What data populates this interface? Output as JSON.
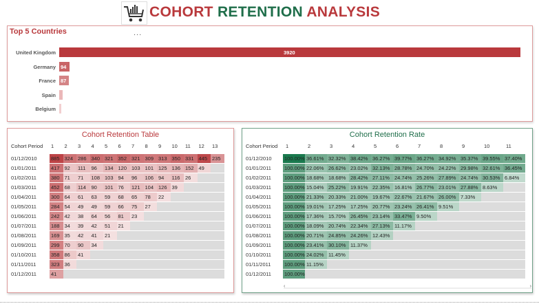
{
  "header": {
    "title_part1": "COHORT",
    "title_part2": "RETENTION",
    "title_part3": "ANALYSIS",
    "logo_icon": "shopping-cart-chart-icon"
  },
  "top_countries": {
    "title": "Top 5 Countries",
    "menu": "...",
    "bar_color": "#b9393c",
    "items": [
      {
        "country": "United Kingdom",
        "value": 3920
      },
      {
        "country": "Germany",
        "value": 94
      },
      {
        "country": "France",
        "value": 87
      },
      {
        "country": "Spain",
        "value": null
      },
      {
        "country": "Belgium",
        "value": null
      }
    ]
  },
  "retention_table": {
    "title": "Cohort Retention Table",
    "period_header": "Cohort Period",
    "columns": [
      "1",
      "2",
      "3",
      "4",
      "5",
      "6",
      "7",
      "8",
      "9",
      "10",
      "11",
      "12",
      "13"
    ],
    "rows": [
      {
        "cohort": "01/12/2010",
        "values": [
          "885",
          "324",
          "286",
          "340",
          "321",
          "352",
          "321",
          "309",
          "313",
          "350",
          "331",
          "445",
          "235"
        ]
      },
      {
        "cohort": "01/01/2011",
        "values": [
          "417",
          "92",
          "111",
          "96",
          "134",
          "120",
          "103",
          "101",
          "125",
          "136",
          "152",
          "49"
        ]
      },
      {
        "cohort": "01/02/2011",
        "values": [
          "380",
          "71",
          "71",
          "108",
          "103",
          "94",
          "96",
          "106",
          "94",
          "116",
          "26"
        ]
      },
      {
        "cohort": "01/03/2011",
        "values": [
          "452",
          "68",
          "114",
          "90",
          "101",
          "76",
          "121",
          "104",
          "126",
          "39"
        ]
      },
      {
        "cohort": "01/04/2011",
        "values": [
          "300",
          "64",
          "61",
          "63",
          "59",
          "68",
          "65",
          "78",
          "22"
        ]
      },
      {
        "cohort": "01/05/2011",
        "values": [
          "284",
          "54",
          "49",
          "49",
          "59",
          "66",
          "75",
          "27"
        ]
      },
      {
        "cohort": "01/06/2011",
        "values": [
          "242",
          "42",
          "38",
          "64",
          "56",
          "81",
          "23"
        ]
      },
      {
        "cohort": "01/07/2011",
        "values": [
          "188",
          "34",
          "39",
          "42",
          "51",
          "21"
        ]
      },
      {
        "cohort": "01/08/2011",
        "values": [
          "169",
          "35",
          "42",
          "41",
          "21"
        ]
      },
      {
        "cohort": "01/09/2011",
        "values": [
          "299",
          "70",
          "90",
          "34"
        ]
      },
      {
        "cohort": "01/10/2011",
        "values": [
          "358",
          "86",
          "41"
        ]
      },
      {
        "cohort": "01/11/2011",
        "values": [
          "323",
          "36"
        ]
      },
      {
        "cohort": "01/12/2011",
        "values": [
          "41"
        ]
      }
    ]
  },
  "retention_rate": {
    "title": "Cohort Retention Rate",
    "period_header": "Cohort Period",
    "columns": [
      "1",
      "2",
      "3",
      "4",
      "5",
      "6",
      "7",
      "8",
      "9",
      "10",
      "11"
    ],
    "rows": [
      {
        "cohort": "01/12/2010",
        "values": [
          "100.00%",
          "36.61%",
          "32.32%",
          "38.42%",
          "36.27%",
          "39.77%",
          "36.27%",
          "34.92%",
          "35.37%",
          "39.55%",
          "37.40%"
        ]
      },
      {
        "cohort": "01/01/2011",
        "values": [
          "100.00%",
          "22.06%",
          "26.62%",
          "23.02%",
          "32.13%",
          "28.78%",
          "24.70%",
          "24.22%",
          "29.98%",
          "32.61%",
          "36.45%"
        ]
      },
      {
        "cohort": "01/02/2011",
        "values": [
          "100.00%",
          "18.68%",
          "18.68%",
          "28.42%",
          "27.11%",
          "24.74%",
          "25.26%",
          "27.89%",
          "24.74%",
          "30.53%",
          "6.84%"
        ]
      },
      {
        "cohort": "01/03/2011",
        "values": [
          "100.00%",
          "15.04%",
          "25.22%",
          "19.91%",
          "22.35%",
          "16.81%",
          "26.77%",
          "23.01%",
          "27.88%",
          "8.63%"
        ]
      },
      {
        "cohort": "01/04/2011",
        "values": [
          "100.00%",
          "21.33%",
          "20.33%",
          "21.00%",
          "19.67%",
          "22.67%",
          "21.67%",
          "26.00%",
          "7.33%"
        ]
      },
      {
        "cohort": "01/05/2011",
        "values": [
          "100.00%",
          "19.01%",
          "17.25%",
          "17.25%",
          "20.77%",
          "23.24%",
          "26.41%",
          "9.51%"
        ]
      },
      {
        "cohort": "01/06/2011",
        "values": [
          "100.00%",
          "17.36%",
          "15.70%",
          "26.45%",
          "23.14%",
          "33.47%",
          "9.50%"
        ]
      },
      {
        "cohort": "01/07/2011",
        "values": [
          "100.00%",
          "18.09%",
          "20.74%",
          "22.34%",
          "27.13%",
          "11.17%"
        ]
      },
      {
        "cohort": "01/08/2011",
        "values": [
          "100.00%",
          "20.71%",
          "24.85%",
          "24.26%",
          "12.43%"
        ]
      },
      {
        "cohort": "01/09/2011",
        "values": [
          "100.00%",
          "23.41%",
          "30.10%",
          "11.37%"
        ]
      },
      {
        "cohort": "01/10/2011",
        "values": [
          "100.00%",
          "24.02%",
          "11.45%"
        ]
      },
      {
        "cohort": "01/11/2011",
        "values": [
          "100.00%",
          "11.15%"
        ]
      },
      {
        "cohort": "01/12/2011",
        "values": [
          "100.00%"
        ]
      }
    ],
    "scroll_left": "‹",
    "scroll_right": "›"
  }
}
